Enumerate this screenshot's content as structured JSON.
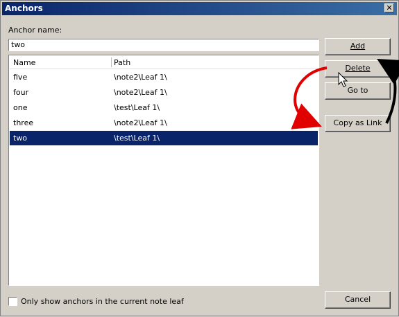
{
  "window": {
    "title": "Anchors"
  },
  "form": {
    "anchor_name_label": "Anchor name:",
    "anchor_name_value": "two"
  },
  "list": {
    "columns": [
      "Name",
      "Path"
    ],
    "rows": [
      {
        "name": "five",
        "path": "\\note2\\Leaf 1\\"
      },
      {
        "name": "four",
        "path": "\\note2\\Leaf 1\\"
      },
      {
        "name": "one",
        "path": "\\test\\Leaf 1\\"
      },
      {
        "name": "three",
        "path": "\\note2\\Leaf 1\\"
      },
      {
        "name": "two",
        "path": "\\test\\Leaf 1\\"
      }
    ],
    "selected_row": "two"
  },
  "buttons": {
    "add": "Add",
    "delete": "Delete",
    "goto": "Go to",
    "copy_link": "Copy as Link",
    "cancel": "Cancel"
  },
  "options": {
    "only_show_label": "Only show anchors in the current note leaf",
    "only_show_checked": false
  },
  "colors": {
    "selection": "#0a246a",
    "title_bar": "#0a246a",
    "arrow_red": "#e00000",
    "arrow_black": "#000000"
  }
}
